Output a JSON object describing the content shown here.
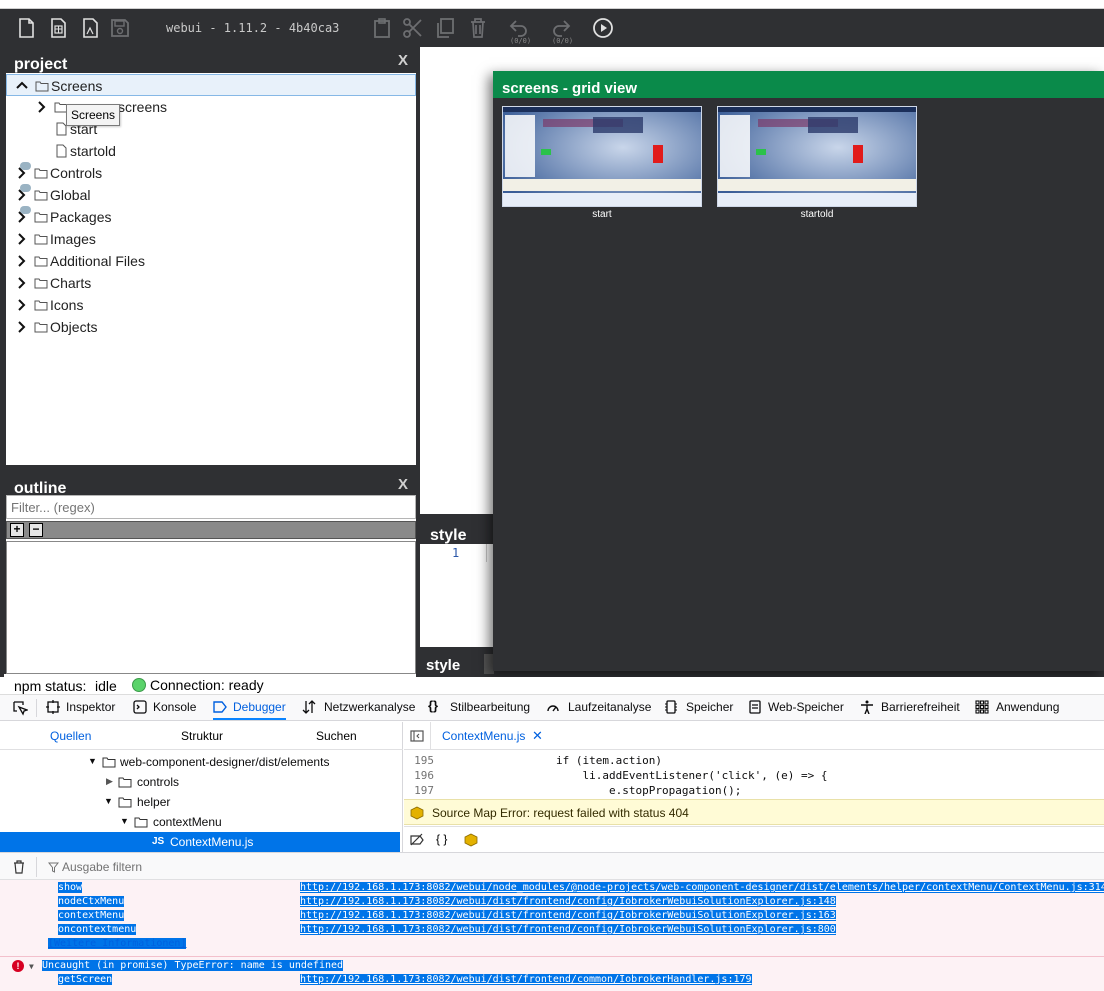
{
  "toolbar": {
    "title": "webui - 1.11.2 - 4b40ca3",
    "undo_count": "(0/0)",
    "redo_count": "(0/0)",
    "icons": [
      "new-file-icon",
      "new-screen-icon",
      "new-control-icon",
      "save-icon",
      "paste-icon",
      "cut-icon",
      "copy-icon",
      "delete-icon",
      "undo-icon",
      "redo-icon",
      "run-icon"
    ]
  },
  "project": {
    "title": "project",
    "close": "X",
    "tooltip": "Screens",
    "tree": [
      {
        "label": "Screens",
        "expanded": true
      },
      {
        "label": "screens"
      },
      {
        "label": "start"
      },
      {
        "label": "startold"
      },
      {
        "label": "Controls"
      },
      {
        "label": "Global"
      },
      {
        "label": "Packages"
      },
      {
        "label": "Images"
      },
      {
        "label": "Additional Files"
      },
      {
        "label": "Charts"
      },
      {
        "label": "Icons"
      },
      {
        "label": "Objects"
      }
    ]
  },
  "outline": {
    "title": "outline",
    "close": "X",
    "filter_placeholder": "Filter... (regex)",
    "expand_label": "+",
    "collapse_label": "−"
  },
  "style": {
    "title": "style",
    "line_number": "1",
    "bottom_tab": "style"
  },
  "gridview": {
    "title": "screens - grid view",
    "screens": [
      {
        "label": "start"
      },
      {
        "label": "startold"
      }
    ]
  },
  "status": {
    "npm_label": "npm status:",
    "npm_value": "idle",
    "connection": "Connection: ready",
    "connection_color": "#5ad36a"
  },
  "devtools": {
    "tabs": [
      {
        "label": "Inspektor"
      },
      {
        "label": "Konsole"
      },
      {
        "label": "Debugger",
        "active": true
      },
      {
        "label": "Netzwerkanalyse"
      },
      {
        "label": "Stilbearbeitung"
      },
      {
        "label": "Laufzeitanalyse"
      },
      {
        "label": "Speicher"
      },
      {
        "label": "Web-Speicher"
      },
      {
        "label": "Barrierefreiheit"
      },
      {
        "label": "Anwendung"
      }
    ],
    "sub_tabs": [
      "Quellen",
      "Struktur",
      "Suchen"
    ],
    "source_tree": [
      {
        "label": "web-component-designer/dist/elements"
      },
      {
        "label": "controls"
      },
      {
        "label": "helper"
      },
      {
        "label": "contextMenu"
      },
      {
        "label": "ContextMenu.js",
        "selected": true
      }
    ],
    "js_badge": "JS",
    "editor_tab": "ContextMenu.js",
    "code_lines": [
      {
        "ln": "195",
        "code": "if (item.action)"
      },
      {
        "ln": "196",
        "code": "    li.addEventListener('click', (e) => {"
      },
      {
        "ln": "197",
        "code": "        e.stopPropagation();"
      }
    ],
    "sourcemap_error": "Source Map Error: request failed with status 404",
    "editor_foot": "{ }",
    "console_filter": "Ausgabe filtern",
    "console_rows": [
      {
        "fn": "show",
        "url": "http://192.168.1.173:8082/webui/node_modules/@node-projects/web-component-designer/dist/elements/helper/contextMenu/ContextMenu.js:314"
      },
      {
        "fn": "nodeCtxMenu",
        "url": "http://192.168.1.173:8082/webui/dist/frontend/config/IobrokerWebuiSolutionExplorer.js:148"
      },
      {
        "fn": "contextMenu",
        "url": "http://192.168.1.173:8082/webui/dist/frontend/config/IobrokerWebuiSolutionExplorer.js:163"
      },
      {
        "fn": "oncontextmenu",
        "url": "http://192.168.1.173:8082/webui/dist/frontend/config/IobrokerWebuiSolutionExplorer.js:800"
      }
    ],
    "more_info": "[Weitere Informationen]",
    "error_text": "Uncaught (in promise) TypeError: name is undefined",
    "error_rows": [
      {
        "fn": "getScreen",
        "url": "http://192.168.1.173:8082/webui/dist/frontend/common/IobrokerHandler.js:179"
      }
    ],
    "colors": {
      "accent": "#0074e8",
      "error_bg": "#fdf2f5",
      "warning_bg": "#fffbd6"
    }
  }
}
